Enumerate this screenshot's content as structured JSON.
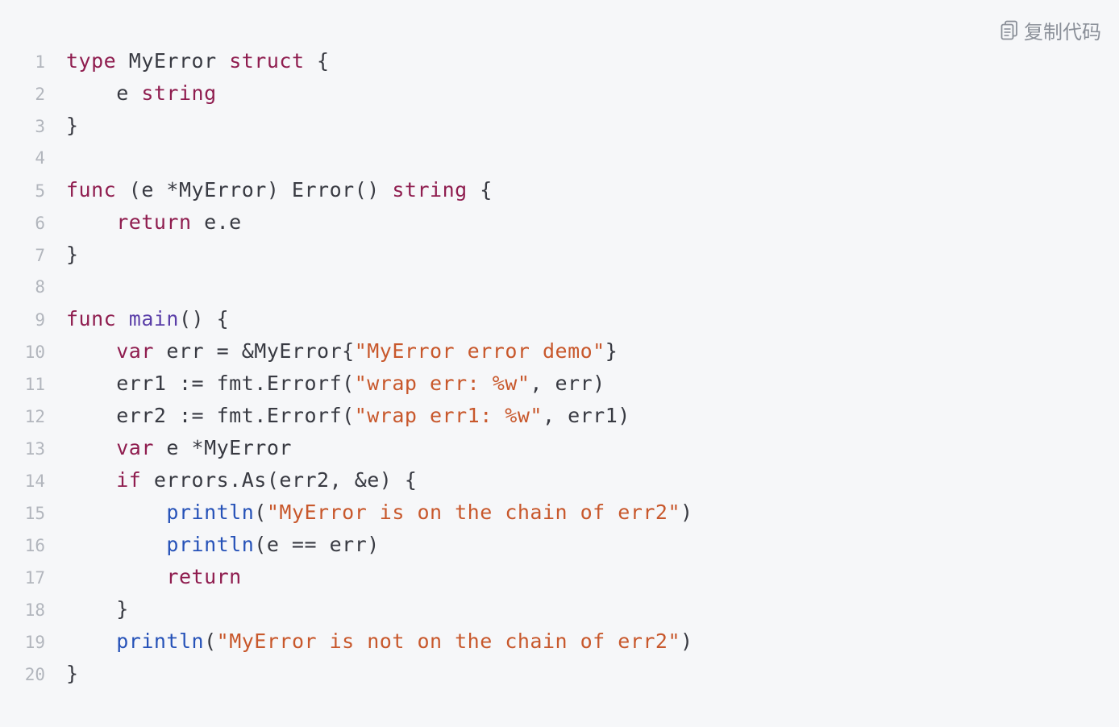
{
  "toolbar": {
    "copy_label": "复制代码",
    "copy_icon": "copy-icon"
  },
  "colors": {
    "background": "#f6f7f9",
    "line_number": "#b2b6bd",
    "keyword": "#8f1d4f",
    "function": "#5a3ea8",
    "string": "#c8582c",
    "builtin": "#2652b8",
    "text": "#383a42"
  },
  "code": {
    "language": "go",
    "lines": [
      {
        "number": "1",
        "tokens": [
          {
            "t": "type",
            "c": "kw"
          },
          {
            "t": " MyError ",
            "c": "plain"
          },
          {
            "t": "struct",
            "c": "kw"
          },
          {
            "t": " {",
            "c": "plain"
          }
        ]
      },
      {
        "number": "2",
        "tokens": [
          {
            "t": "    e ",
            "c": "plain"
          },
          {
            "t": "string",
            "c": "kw"
          }
        ]
      },
      {
        "number": "3",
        "tokens": [
          {
            "t": "}",
            "c": "plain"
          }
        ]
      },
      {
        "number": "4",
        "tokens": []
      },
      {
        "number": "5",
        "tokens": [
          {
            "t": "func",
            "c": "kw"
          },
          {
            "t": " (e *MyError) Error() ",
            "c": "plain"
          },
          {
            "t": "string",
            "c": "kw"
          },
          {
            "t": " {",
            "c": "plain"
          }
        ]
      },
      {
        "number": "6",
        "tokens": [
          {
            "t": "    ",
            "c": "plain"
          },
          {
            "t": "return",
            "c": "kw"
          },
          {
            "t": " e.e",
            "c": "plain"
          }
        ]
      },
      {
        "number": "7",
        "tokens": [
          {
            "t": "}",
            "c": "plain"
          }
        ]
      },
      {
        "number": "8",
        "tokens": []
      },
      {
        "number": "9",
        "tokens": [
          {
            "t": "func",
            "c": "kw"
          },
          {
            "t": " ",
            "c": "plain"
          },
          {
            "t": "main",
            "c": "fn"
          },
          {
            "t": "() {",
            "c": "plain"
          }
        ]
      },
      {
        "number": "10",
        "tokens": [
          {
            "t": "    ",
            "c": "plain"
          },
          {
            "t": "var",
            "c": "kw"
          },
          {
            "t": " err = &MyError{",
            "c": "plain"
          },
          {
            "t": "\"MyError error demo\"",
            "c": "str"
          },
          {
            "t": "}",
            "c": "plain"
          }
        ]
      },
      {
        "number": "11",
        "tokens": [
          {
            "t": "    err1 := fmt.Errorf(",
            "c": "plain"
          },
          {
            "t": "\"wrap err: %w\"",
            "c": "str"
          },
          {
            "t": ", err)",
            "c": "plain"
          }
        ]
      },
      {
        "number": "12",
        "tokens": [
          {
            "t": "    err2 := fmt.Errorf(",
            "c": "plain"
          },
          {
            "t": "\"wrap err1: %w\"",
            "c": "str"
          },
          {
            "t": ", err1)",
            "c": "plain"
          }
        ]
      },
      {
        "number": "13",
        "tokens": [
          {
            "t": "    ",
            "c": "plain"
          },
          {
            "t": "var",
            "c": "kw"
          },
          {
            "t": " e *MyError",
            "c": "plain"
          }
        ]
      },
      {
        "number": "14",
        "tokens": [
          {
            "t": "    ",
            "c": "plain"
          },
          {
            "t": "if",
            "c": "kw"
          },
          {
            "t": " errors.As(err2, &e) {",
            "c": "plain"
          }
        ]
      },
      {
        "number": "15",
        "tokens": [
          {
            "t": "        ",
            "c": "plain"
          },
          {
            "t": "println",
            "c": "builtin"
          },
          {
            "t": "(",
            "c": "plain"
          },
          {
            "t": "\"MyError is on the chain of err2\"",
            "c": "str"
          },
          {
            "t": ")",
            "c": "plain"
          }
        ]
      },
      {
        "number": "16",
        "tokens": [
          {
            "t": "        ",
            "c": "plain"
          },
          {
            "t": "println",
            "c": "builtin"
          },
          {
            "t": "(e == err)",
            "c": "plain"
          }
        ]
      },
      {
        "number": "17",
        "tokens": [
          {
            "t": "        ",
            "c": "plain"
          },
          {
            "t": "return",
            "c": "kw"
          }
        ]
      },
      {
        "number": "18",
        "tokens": [
          {
            "t": "    }",
            "c": "plain"
          }
        ]
      },
      {
        "number": "19",
        "tokens": [
          {
            "t": "    ",
            "c": "plain"
          },
          {
            "t": "println",
            "c": "builtin"
          },
          {
            "t": "(",
            "c": "plain"
          },
          {
            "t": "\"MyError is not on the chain of err2\"",
            "c": "str"
          },
          {
            "t": ")",
            "c": "plain"
          }
        ]
      },
      {
        "number": "20",
        "tokens": [
          {
            "t": "}",
            "c": "plain"
          }
        ]
      }
    ]
  }
}
